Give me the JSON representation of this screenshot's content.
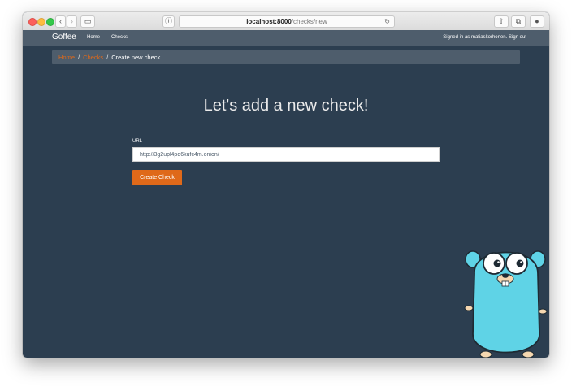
{
  "browser": {
    "url_host": "localhost:8000",
    "url_path": "/checks/new",
    "reload_icon": "reload-icon",
    "icons": [
      "back-icon",
      "forward-icon",
      "sidebar-icon",
      "privacy-icon",
      "share-icon",
      "tabs-icon",
      "download-icon"
    ]
  },
  "nav": {
    "brand": "Goffee",
    "links": [
      "Home",
      "Checks"
    ],
    "signed_in": "Signed in as matiaskorhonen. Sign out"
  },
  "breadcrumb": {
    "items": [
      "Home",
      "Checks",
      "Create new check"
    ],
    "separator": "/"
  },
  "main": {
    "heading": "Let's add a new check!",
    "url_label": "URL",
    "url_value": "http://3g2upl4pq6kufc4m.onion/",
    "submit_label": "Create Check"
  },
  "colors": {
    "background": "#2c3e50",
    "navbar": "#4e5d6c",
    "accent": "#df691a"
  }
}
